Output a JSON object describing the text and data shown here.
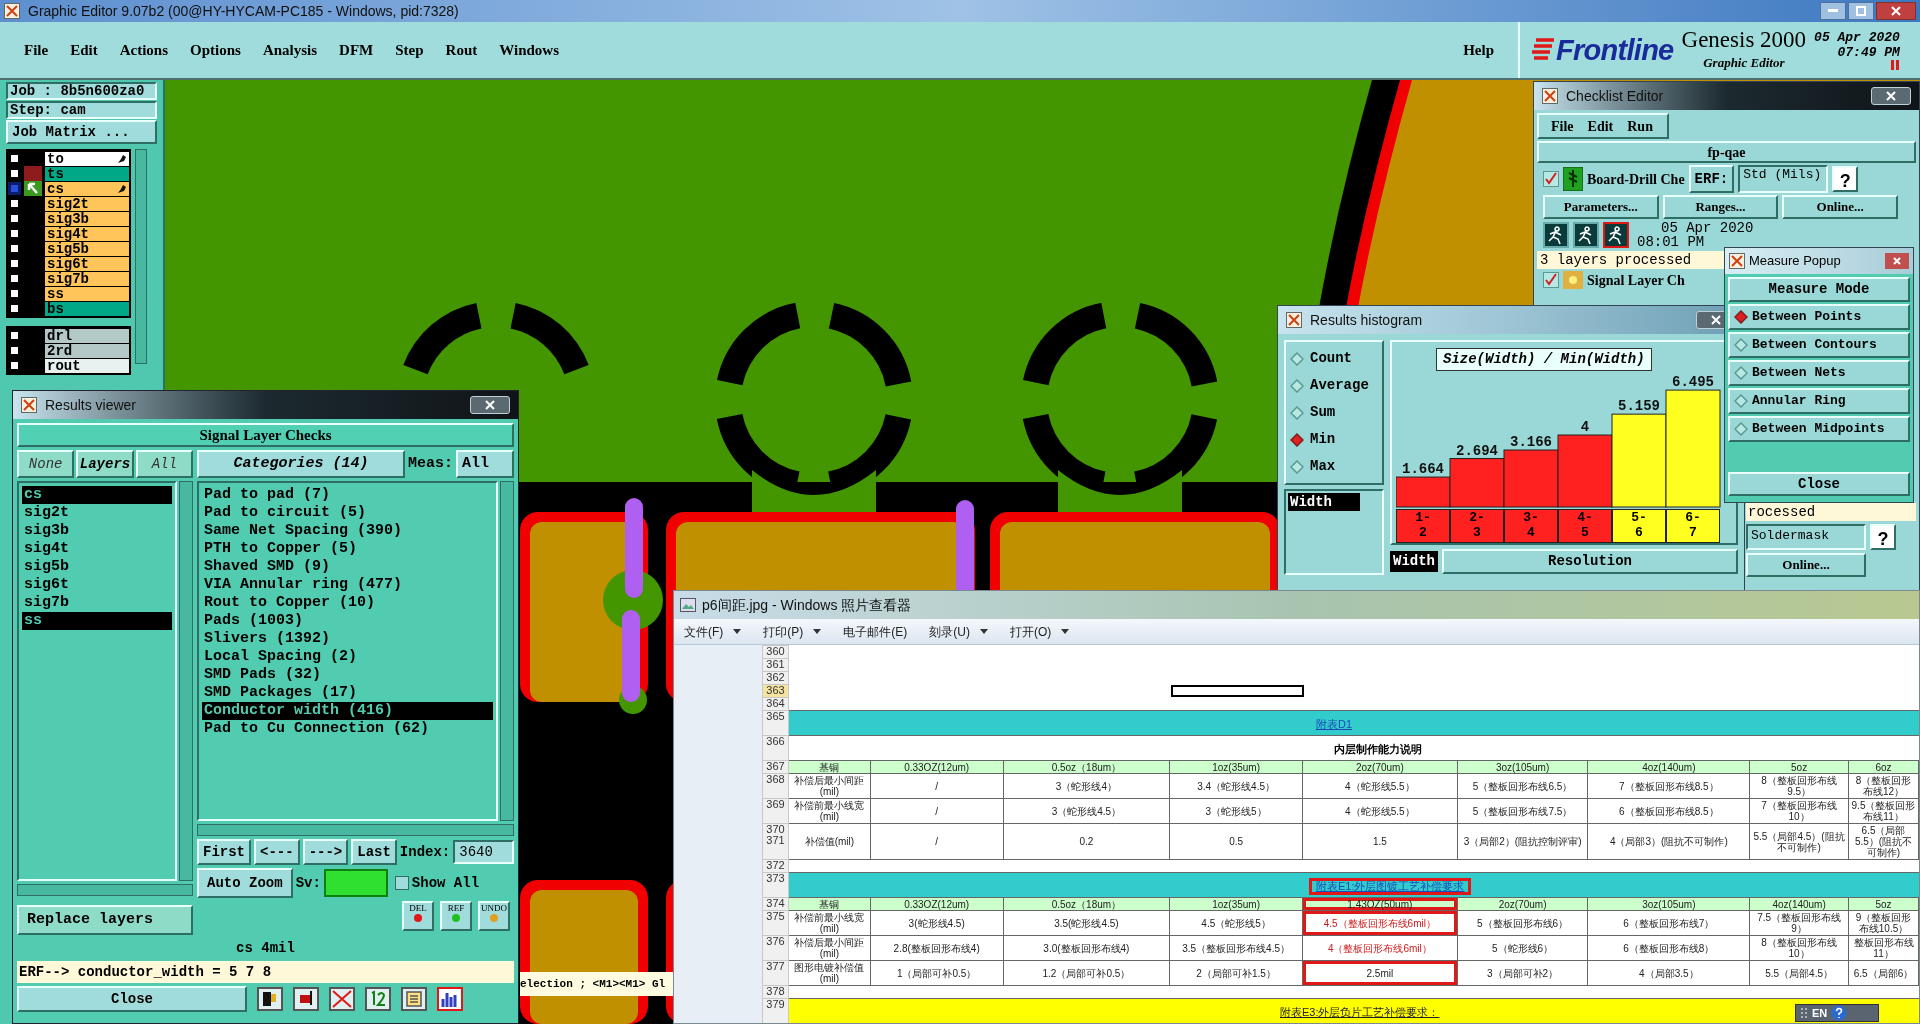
{
  "window": {
    "title": "Graphic Editor 9.07b2 (00@HY-HYCAM-PC185 - Windows, pid:7328)"
  },
  "menu": [
    "File",
    "Edit",
    "Actions",
    "Options",
    "Analysis",
    "DFM",
    "Step",
    "Rout",
    "Windows"
  ],
  "help": "Help",
  "brand": {
    "logo": "Frontline",
    "product": "Genesis 2000",
    "subtitle": "Graphic Editor",
    "date": "05 Apr 2020",
    "time": "07:49 PM"
  },
  "job": {
    "job": "Job : 8b5n600za0",
    "step": "Step: cam",
    "matrix_button": "Job Matrix ..."
  },
  "layers": [
    {
      "name": "to",
      "color": "#ffffff",
      "selected": false,
      "affected": false,
      "editable": true
    },
    {
      "name": "ts",
      "color": "#00a888",
      "selected": false,
      "affected": true,
      "editable": false
    },
    {
      "name": "cs",
      "color": "#ffc45a",
      "selected": true,
      "affected": false,
      "editable": true
    },
    {
      "name": "sig2t",
      "color": "#ffc45a",
      "selected": false,
      "affected": false,
      "editable": false
    },
    {
      "name": "sig3b",
      "color": "#ffc45a",
      "selected": false,
      "affected": false,
      "editable": false
    },
    {
      "name": "sig4t",
      "color": "#ffc45a",
      "selected": false,
      "affected": false,
      "editable": false
    },
    {
      "name": "sig5b",
      "color": "#ffc45a",
      "selected": false,
      "affected": false,
      "editable": false
    },
    {
      "name": "sig6t",
      "color": "#ffc45a",
      "selected": false,
      "affected": false,
      "editable": false
    },
    {
      "name": "sig7b",
      "color": "#ffc45a",
      "selected": false,
      "affected": false,
      "editable": false
    },
    {
      "name": "ss",
      "color": "#ffc45a",
      "selected": false,
      "affected": false,
      "editable": false
    },
    {
      "name": "bs",
      "color": "#00a888",
      "selected": false,
      "affected": false,
      "editable": false
    }
  ],
  "drill_layers": [
    {
      "name": "drl",
      "color": "#b4c8c8",
      "selected": false,
      "affected": false,
      "editable": false
    },
    {
      "name": "2rd",
      "color": "#b4c8c8",
      "selected": false,
      "affected": false,
      "editable": false
    },
    {
      "name": "rout",
      "color": "#e8f0f0",
      "selected": false,
      "affected": false,
      "editable": false
    }
  ],
  "results_viewer": {
    "title": "Results viewer",
    "heading": "Signal Layer Checks",
    "layer_buttons": [
      "None",
      "Layers",
      "All"
    ],
    "categories_label": "Categories (14)",
    "meas_label": "Meas:",
    "meas_value": "All",
    "layers": [
      {
        "name": "cs",
        "selected": true
      },
      {
        "name": "sig2t",
        "selected": false
      },
      {
        "name": "sig3b",
        "selected": false
      },
      {
        "name": "sig4t",
        "selected": false
      },
      {
        "name": "sig5b",
        "selected": false
      },
      {
        "name": "sig6t",
        "selected": false
      },
      {
        "name": "sig7b",
        "selected": false
      },
      {
        "name": "ss",
        "selected": true
      }
    ],
    "categories": [
      {
        "name": "Pad to pad (7)",
        "selected": false
      },
      {
        "name": "Pad to circuit (5)",
        "selected": false
      },
      {
        "name": "Same Net Spacing (390)",
        "selected": false
      },
      {
        "name": "PTH to Copper (5)",
        "selected": false
      },
      {
        "name": "Shaved SMD (9)",
        "selected": false
      },
      {
        "name": "VIA Annular ring (477)",
        "selected": false
      },
      {
        "name": "Rout to Copper (10)",
        "selected": false
      },
      {
        "name": "Pads (1003)",
        "selected": false
      },
      {
        "name": "Slivers (1392)",
        "selected": false
      },
      {
        "name": "Local Spacing (2)",
        "selected": false
      },
      {
        "name": "SMD Pads (32)",
        "selected": false
      },
      {
        "name": "SMD Packages (17)",
        "selected": false
      },
      {
        "name": "Conductor width (416)",
        "selected": true
      },
      {
        "name": "Pad to Cu Connection (62)",
        "selected": false
      }
    ],
    "nav": [
      "First",
      "<---",
      "--->",
      "Last"
    ],
    "index_label": "Index:",
    "index_value": "3640",
    "zoom": "Auto Zoom",
    "sv_label": "Sv:",
    "show_all": {
      "label": "Show All",
      "checked": false
    },
    "replace": "Replace layers",
    "tools": [
      "DEL",
      "REF",
      "UNDO"
    ],
    "current": "cs 4mil",
    "erf": "ERF--> conductor_width = 5 7 8",
    "close": "Close"
  },
  "status_line": "election ; <M1><M1> Gl",
  "checklist": {
    "title": "Checklist Editor",
    "menu": [
      "File",
      "Edit",
      "Run"
    ],
    "name": "fp-qae",
    "checks": [
      {
        "name": "Board-Drill Che",
        "checked": true
      },
      {
        "name": "Signal Layer Ch",
        "checked": true
      }
    ],
    "erf_label": "ERF:",
    "erf_value": "Std (Mils)",
    "help": "?",
    "buttons": [
      "Parameters...",
      "Ranges...",
      "Online..."
    ],
    "date": "05 Apr 2020",
    "time": "08:01 PM",
    "status": "3 layers processed",
    "lower_status": "rocessed",
    "lower_erf_value": "Soldermask",
    "lower_help": "?",
    "lower_button": "Online..."
  },
  "histogram": {
    "title": "Results histogram",
    "modes": [
      {
        "label": "Count",
        "selected": false
      },
      {
        "label": "Average",
        "selected": false
      },
      {
        "label": "Sum",
        "selected": false
      },
      {
        "label": "Min",
        "selected": true
      },
      {
        "label": "Max",
        "selected": false
      }
    ],
    "fields": [
      {
        "label": "Width",
        "selected": true
      }
    ],
    "chart_data": {
      "type": "bar",
      "title": "Size(Width) / Min(Width)",
      "categories": [
        "1-2",
        "2-3",
        "3-4",
        "4-5",
        "5-6",
        "6-7"
      ],
      "values": [
        1.664,
        2.694,
        3.166,
        4,
        5.159,
        6.495
      ],
      "data_labels": true
    },
    "bins": [
      {
        "color": "#ff2020"
      },
      {
        "color": "#ff2020"
      },
      {
        "color": "#ff2020"
      },
      {
        "color": "#ff2020"
      },
      {
        "color": "#ffff20"
      },
      {
        "color": "#ffff20"
      }
    ],
    "value_field": "Width",
    "resolution": "Resolution"
  },
  "measure_popup": {
    "title": "Measure Popup",
    "heading": "Measure Mode",
    "modes": [
      {
        "label": "Between Points",
        "selected": true
      },
      {
        "label": "Between Contours",
        "selected": false
      },
      {
        "label": "Between Nets",
        "selected": false
      },
      {
        "label": "Annular Ring",
        "selected": false
      },
      {
        "label": "Between Midpoints",
        "selected": false
      }
    ],
    "close": "Close"
  },
  "photo_viewer": {
    "title": "p6间距.jpg - Windows 照片查看器",
    "menu": [
      {
        "label": "文件(F)",
        "dropdown": true
      },
      {
        "label": "打印(P)",
        "dropdown": true
      },
      {
        "label": "电子邮件(E)",
        "dropdown": false
      },
      {
        "label": "刻录(U)",
        "dropdown": true
      },
      {
        "label": "打开(O)",
        "dropdown": true
      }
    ],
    "language": "EN",
    "rows": [
      {
        "numbers": [
          "360"
        ],
        "kind": "blank",
        "selected": false
      },
      {
        "numbers": [
          "361"
        ],
        "kind": "blank",
        "selected": false
      },
      {
        "numbers": [
          "362"
        ],
        "kind": "blank",
        "selected": false
      },
      {
        "numbers": [
          "363"
        ],
        "kind": "blank",
        "selected": true
      },
      {
        "numbers": [
          "364"
        ],
        "kind": "blank",
        "selected": false
      },
      {
        "numbers": [
          "365"
        ],
        "kind": "band",
        "title": "附表D1",
        "framed": false,
        "selected": false
      },
      {
        "numbers": [
          "366"
        ],
        "kind": "caption",
        "title": "内层制作能力说明",
        "selected": false
      },
      {
        "numbers": [
          "367"
        ],
        "kind": "header",
        "label": "基铜",
        "cells": [
          "0.33OZ(12um)",
          "0.5oz（18um）",
          "1oz(35um)",
          "2oz(70um)",
          "3oz(105um)",
          "4oz(140um)",
          "5oz",
          "6oz"
        ],
        "selected": false
      },
      {
        "numbers": [
          "368"
        ],
        "kind": "data",
        "label": "补偿后最小间距(mil)",
        "cells": [
          "/",
          "3（蛇形线4）",
          "3.4（蛇形线4.5）",
          "4（蛇形线5.5）",
          "5（整板回形布线6.5）",
          "7（整板回形布线8.5）",
          "8（整板回形布线9.5）",
          "8（整板回形布线12）"
        ],
        "selected": false
      },
      {
        "numbers": [
          "369"
        ],
        "kind": "data",
        "label": "补偿前最小线宽(mil)",
        "cells": [
          "/",
          "3（蛇形线4.5）",
          "3（蛇形线5）",
          "4（蛇形线5.5）",
          "5（整板回形布线7.5）",
          "6（整板回形布线8.5）",
          "7（整板回形布线10）",
          "9.5（整板回形布线11）"
        ],
        "selected": false
      },
      {
        "numbers": [
          "370",
          "371"
        ],
        "kind": "data",
        "label": "补偿值(mil)",
        "cells": [
          "/",
          "0.2",
          "0.5",
          "1.5",
          "3（局部2）(阻抗控制评审)",
          "4（局部3）(阻抗不可制作)",
          "5.5（局部4.5）(阻抗不可制作)",
          "6.5（局部5.5）(阻抗不可制作)"
        ],
        "selected": false
      },
      {
        "numbers": [
          "372"
        ],
        "kind": "blank",
        "selected": false
      },
      {
        "numbers": [
          "373"
        ],
        "kind": "band",
        "title": "附表E1:外层图镀工艺补偿要求",
        "framed": true,
        "selected": false
      },
      {
        "numbers": [
          "374"
        ],
        "kind": "header",
        "label": "基铜",
        "cells": [
          "0.33OZ(12um)",
          "0.5oz（18um）",
          "1oz(35um)",
          {
            "text": "1.43OZ(50um)",
            "red": false,
            "framed": true
          },
          "2oz(70um)",
          "3oz(105um)",
          "4oz(140um)",
          "5oz"
        ],
        "selected": false
      },
      {
        "numbers": [
          "375"
        ],
        "kind": "data",
        "label": "补偿前最小线宽(mil)",
        "cells": [
          "3(蛇形线4.5)",
          "3.5(蛇形线4.5)",
          "4.5（蛇形线5）",
          {
            "text": "4.5（整板回形布线6mil）",
            "red": true,
            "framed": true
          },
          "5（整板回形布线6）",
          "6（整板回形布线7）",
          "7.5（整板回形布线9）",
          "9（整板回形布线10.5）"
        ],
        "selected": false
      },
      {
        "numbers": [
          "376"
        ],
        "kind": "data",
        "label": "补偿后最小间距(mil)",
        "cells": [
          "2.8(整板回形布线4)",
          "3.0(整板回形布线4)",
          "3.5（整板回形布线4.5）",
          {
            "text": "4（整板回形布线6mil）",
            "red": true,
            "framed": false
          },
          "5（蛇形线6）",
          "6（整板回形布线8）",
          "8（整板回形布线10）",
          "整板回形布线11）"
        ],
        "selected": false
      },
      {
        "numbers": [
          "377"
        ],
        "kind": "data",
        "label": "图形电镀补偿值(mil)",
        "cells": [
          "1（局部可补0.5）",
          "1.2（局部可补0.5）",
          "2（局部可补1.5）",
          {
            "text": "2.5mil",
            "red": false,
            "framed": true
          },
          "3（局部可补2）",
          "4（局部3.5）",
          "5.5（局部4.5）",
          "6.5（局部6）"
        ],
        "selected": false
      },
      {
        "numbers": [
          "378"
        ],
        "kind": "blank",
        "selected": false
      },
      {
        "numbers": [
          "379"
        ],
        "kind": "yellow_band",
        "title": "附表E3:外层负片工艺补偿要求：",
        "framed": false,
        "selected": false
      }
    ]
  }
}
